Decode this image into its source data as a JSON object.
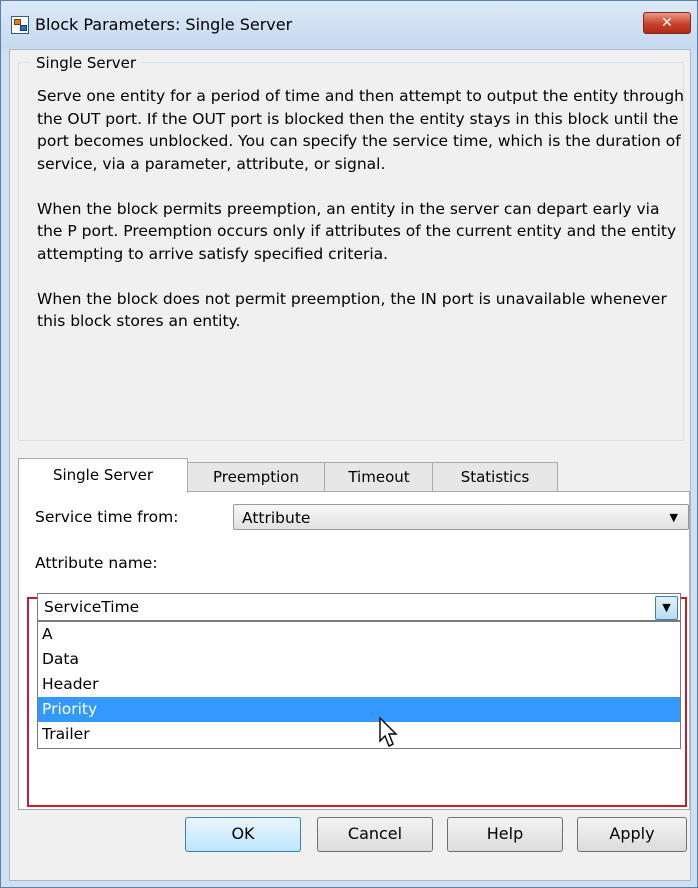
{
  "window": {
    "title": "Block Parameters: Single Server",
    "close_symbol": "✕",
    "icon": "simulink-block-icon"
  },
  "group": {
    "legend": "Single Server",
    "paragraphs": [
      "Serve one entity for a period of time and then attempt to output the entity through the OUT port. If the OUT port is blocked then the entity stays in this block until the port becomes unblocked. You can specify the service time, which is the duration of service, via a parameter, attribute, or signal.",
      "When the block permits preemption, an entity in the server can depart early via the P port. Preemption occurs only if attributes of the current entity and the entity attempting to arrive satisfy specified criteria.",
      "When the block does not permit preemption, the IN port is unavailable whenever this block stores an entity."
    ]
  },
  "tabs": [
    {
      "label": "Single Server",
      "active": true
    },
    {
      "label": "Preemption",
      "active": false
    },
    {
      "label": "Timeout",
      "active": false
    },
    {
      "label": "Statistics",
      "active": false
    }
  ],
  "service_time": {
    "label": "Service time from:",
    "value": "Attribute"
  },
  "attribute": {
    "label": "Attribute name:",
    "value": "ServiceTime",
    "options": [
      "A",
      "Data",
      "Header",
      "Priority",
      "Trailer"
    ],
    "highlighted": "Priority"
  },
  "buttons": {
    "ok": "OK",
    "cancel": "Cancel",
    "help": "Help",
    "apply": "Apply"
  },
  "colors": {
    "selection": "#3399ff",
    "highlight_border": "#c0202a",
    "title_bar": "#cfe0f1"
  }
}
